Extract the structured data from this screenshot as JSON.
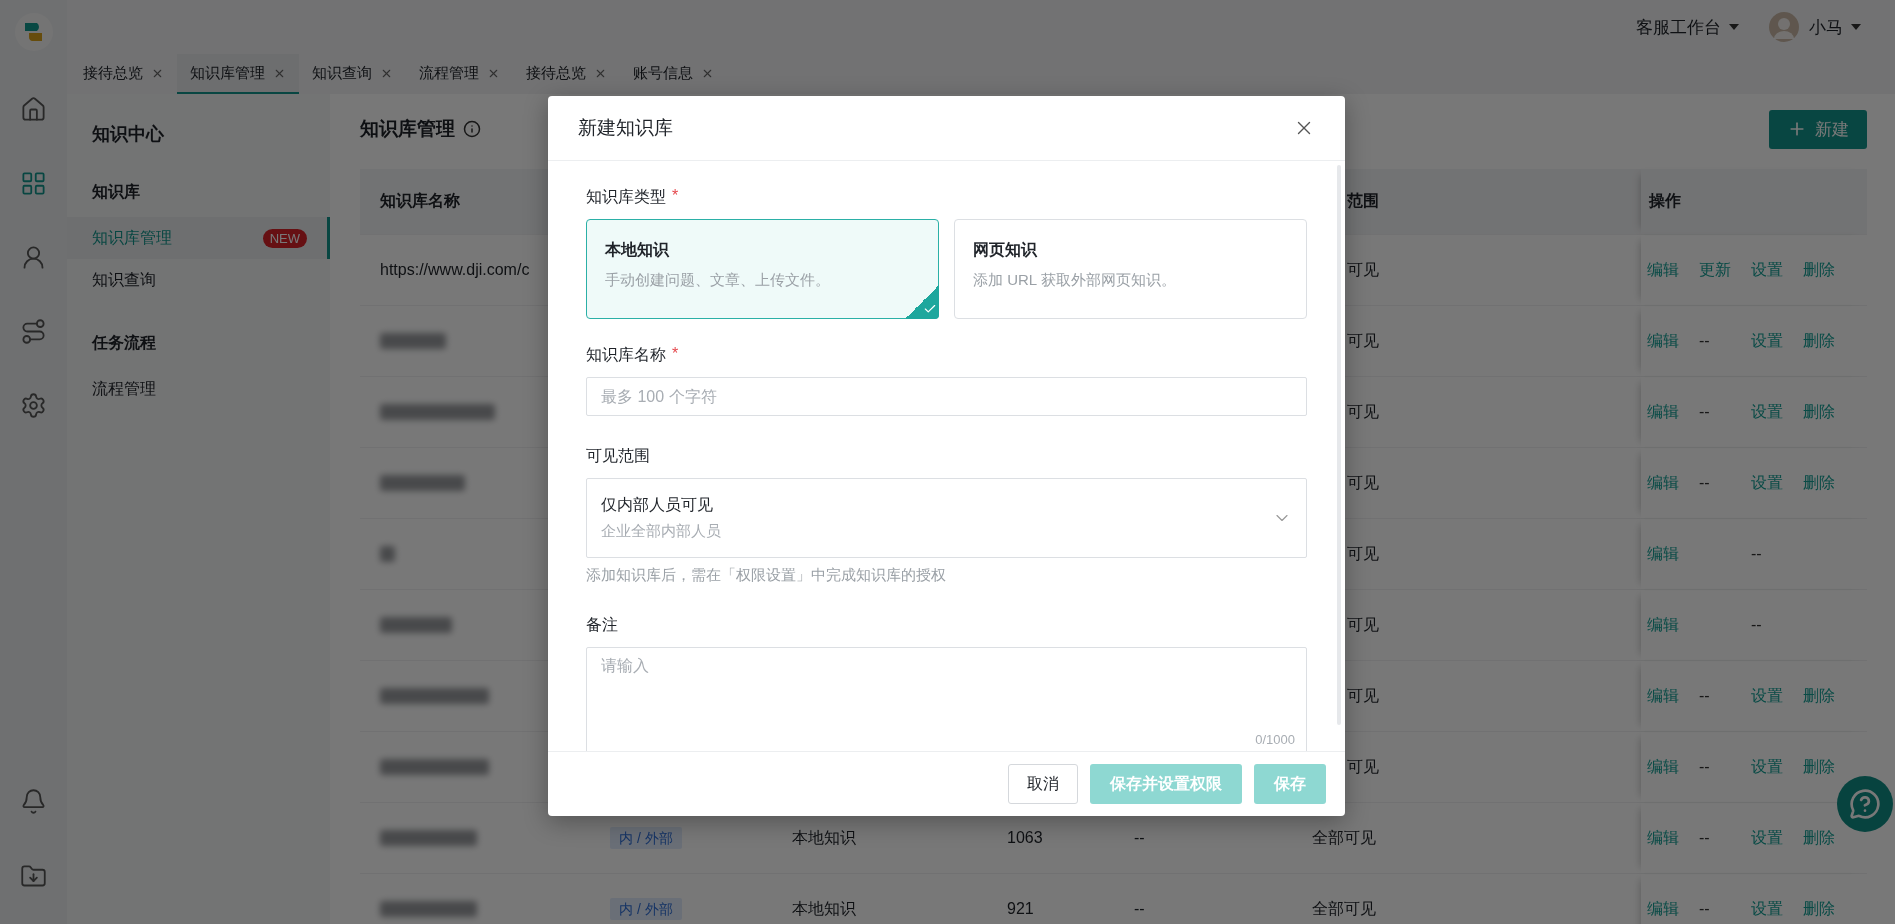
{
  "header": {
    "workspace_menu": "客服工作台",
    "user_name": "小马"
  },
  "rail": {
    "top": [
      {
        "kind": "home",
        "selected": false
      },
      {
        "kind": "grid",
        "selected": true
      },
      {
        "kind": "person",
        "selected": false
      },
      {
        "kind": "route",
        "selected": false
      },
      {
        "kind": "settings",
        "selected": false
      }
    ],
    "bottom": [
      {
        "kind": "bell",
        "selected": false
      },
      {
        "kind": "download",
        "selected": false
      }
    ]
  },
  "tabs": [
    {
      "label": "接待总览",
      "selected": false
    },
    {
      "label": "知识库管理",
      "selected": true
    },
    {
      "label": "知识查询",
      "selected": false
    },
    {
      "label": "流程管理",
      "selected": false
    },
    {
      "label": "接待总览",
      "selected": false
    },
    {
      "label": "账号信息",
      "selected": false
    }
  ],
  "sidebar": {
    "title": "知识中心",
    "groups": [
      {
        "label": "知识库",
        "items": [
          {
            "label": "知识库管理",
            "badge": "NEW",
            "selected": true
          },
          {
            "label": "知识查询",
            "selected": false
          }
        ]
      },
      {
        "label": "任务流程",
        "items": [
          {
            "label": "流程管理",
            "selected": false
          }
        ]
      }
    ]
  },
  "page": {
    "title": "知识库管理",
    "new_button": "新建"
  },
  "table": {
    "columns": {
      "name": "知识库名称",
      "scope": "范围",
      "actions": "操作"
    },
    "rows": [
      {
        "name": "https://www.dji.com/c",
        "blurred": false,
        "scope": "可见",
        "actions": [
          {
            "label": "编辑",
            "kind": "link"
          },
          {
            "label": "更新",
            "kind": "link"
          },
          {
            "label": "设置",
            "kind": "link"
          },
          {
            "label": "删除",
            "kind": "link"
          }
        ]
      },
      {
        "blurred": true,
        "scope": "可见",
        "actions": [
          {
            "label": "编辑",
            "kind": "link"
          },
          {
            "label": "--",
            "kind": "empty"
          },
          {
            "label": "设置",
            "kind": "link"
          },
          {
            "label": "删除",
            "kind": "link"
          }
        ]
      },
      {
        "blurred": true,
        "scope": "可见",
        "actions": [
          {
            "label": "编辑",
            "kind": "link"
          },
          {
            "label": "--",
            "kind": "empty"
          },
          {
            "label": "设置",
            "kind": "link"
          },
          {
            "label": "删除",
            "kind": "link"
          }
        ]
      },
      {
        "blurred": true,
        "scope": "可见",
        "actions": [
          {
            "label": "编辑",
            "kind": "link"
          },
          {
            "label": "--",
            "kind": "empty"
          },
          {
            "label": "设置",
            "kind": "link"
          },
          {
            "label": "删除",
            "kind": "link"
          }
        ]
      },
      {
        "blurred": true,
        "scope": "可见",
        "actions": [
          {
            "label": "编辑",
            "kind": "link"
          },
          {
            "kind": "gap"
          },
          {
            "label": "--",
            "kind": "empty"
          }
        ]
      },
      {
        "blurred": true,
        "scope": "可见",
        "actions": [
          {
            "label": "编辑",
            "kind": "link"
          },
          {
            "kind": "gap"
          },
          {
            "label": "--",
            "kind": "empty"
          }
        ]
      },
      {
        "blurred": true,
        "scope": "可见",
        "actions": [
          {
            "label": "编辑",
            "kind": "link"
          },
          {
            "label": "--",
            "kind": "empty"
          },
          {
            "label": "设置",
            "kind": "link"
          },
          {
            "label": "删除",
            "kind": "link"
          }
        ]
      },
      {
        "blurred": true,
        "scope": "可见",
        "actions": [
          {
            "label": "编辑",
            "kind": "link"
          },
          {
            "label": "--",
            "kind": "empty"
          },
          {
            "label": "设置",
            "kind": "link"
          },
          {
            "label": "删除",
            "kind": "link"
          }
        ]
      },
      {
        "blurred": true,
        "tag": "内 / 外部",
        "type": "本地知识",
        "count": "1063",
        "column_5": "--",
        "scope": "全部可见",
        "actions": [
          {
            "label": "编辑",
            "kind": "link"
          },
          {
            "label": "--",
            "kind": "empty"
          },
          {
            "label": "设置",
            "kind": "link"
          },
          {
            "label": "删除",
            "kind": "link"
          }
        ]
      },
      {
        "blurred": true,
        "tag": "内 / 外部",
        "type": "本地知识",
        "count": "921",
        "column_5": "--",
        "scope": "全部可见",
        "actions": [
          {
            "label": "编辑",
            "kind": "link"
          },
          {
            "label": "--",
            "kind": "empty"
          },
          {
            "label": "设置",
            "kind": "link"
          },
          {
            "label": "删除",
            "kind": "link"
          }
        ]
      }
    ]
  },
  "dialog": {
    "title": "新建知识库",
    "type_field": {
      "label": "知识库类型",
      "required_mark": "*",
      "options": [
        {
          "title": "本地知识",
          "description": "手动创建问题、文章、上传文件。",
          "selected": true
        },
        {
          "title": "网页知识",
          "description": "添加 URL 获取外部网页知识。",
          "selected": false
        }
      ]
    },
    "name_field": {
      "label": "知识库名称",
      "required_mark": "*",
      "placeholder": "最多 100 个字符"
    },
    "scope_field": {
      "label": "可见范围",
      "value": "仅内部人员可见",
      "description": "企业全部内部人员",
      "hint": "添加知识库后，需在「权限设置」中完成知识库的授权"
    },
    "remark_field": {
      "label": "备注",
      "placeholder": "请输入",
      "counter": "0/1000"
    },
    "buttons": [
      {
        "label": "取消",
        "kind": "default",
        "disabled": false
      },
      {
        "label": "保存并设置权限",
        "kind": "primary",
        "disabled": true
      },
      {
        "label": "保存",
        "kind": "primary",
        "disabled": true
      }
    ]
  }
}
